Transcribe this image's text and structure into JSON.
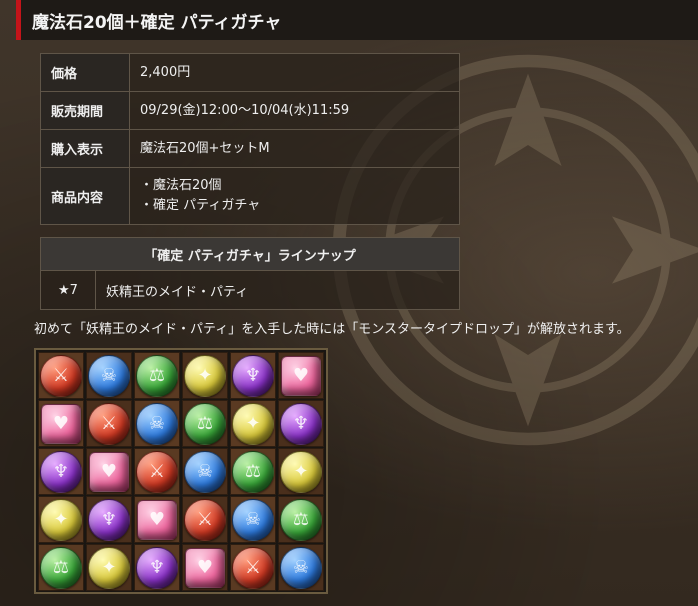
{
  "header": {
    "title": "魔法石20個＋確定 パティガチャ"
  },
  "info_rows": [
    {
      "label": "価格",
      "value_lines": [
        "2,400円"
      ]
    },
    {
      "label": "販売期間",
      "value_lines": [
        "09/29(金)12:00～10/04(水)11:59"
      ]
    },
    {
      "label": "購入表示",
      "value_lines": [
        "魔法石20個+セットM"
      ]
    },
    {
      "label": "商品内容",
      "value_lines": [
        "・魔法石20個",
        "・確定 パティガチャ"
      ]
    }
  ],
  "lineup": {
    "header": "「確定 パティガチャ」ラインナップ",
    "rows": [
      {
        "rarity": "★7",
        "name": "妖精王のメイド・パティ"
      }
    ]
  },
  "note": "初めて「妖精王のメイド・パティ」を入手した時には「モンスタータイプドロップ」が解放されます。",
  "board": {
    "icon_map": {
      "fire": "sword-icon",
      "water": "skull-icon",
      "wood": "scale-icon",
      "light": "angel-icon",
      "dark": "devil-icon",
      "heart": "heart-icon"
    },
    "rows": [
      [
        "fire",
        "water",
        "wood",
        "light",
        "dark",
        "heart"
      ],
      [
        "heart",
        "fire",
        "water",
        "wood",
        "light",
        "dark"
      ],
      [
        "dark",
        "heart",
        "fire",
        "water",
        "wood",
        "light"
      ],
      [
        "light",
        "dark",
        "heart",
        "fire",
        "water",
        "wood"
      ],
      [
        "wood",
        "light",
        "dark",
        "heart",
        "fire",
        "water"
      ]
    ],
    "glyphs": {
      "fire": "⚔",
      "water": "☠",
      "wood": "⚖",
      "light": "✦",
      "dark": "♆",
      "heart": "♥"
    }
  }
}
